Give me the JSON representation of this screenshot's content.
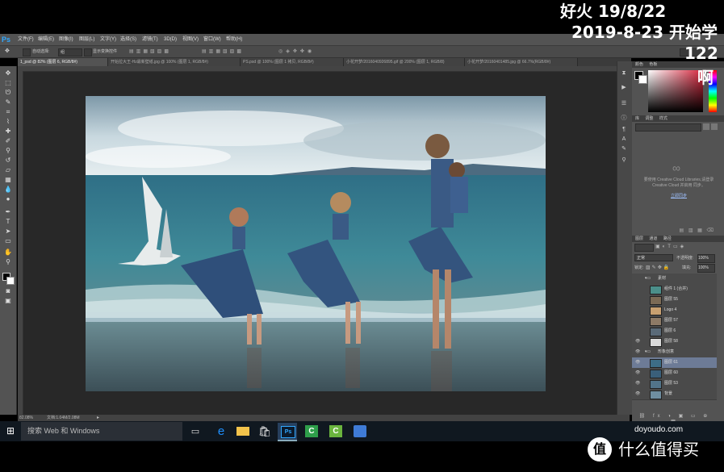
{
  "overlay": {
    "line1": "好火        19/8/22",
    "line2": "2019-8-23  开始学",
    "line3": "122",
    "line4": "啊"
  },
  "app": {
    "logo": "Ps",
    "menu": [
      "文件(F)",
      "编辑(E)",
      "图像(I)",
      "图层(L)",
      "文字(Y)",
      "选择(S)",
      "滤镜(T)",
      "3D(D)",
      "视图(V)",
      "窗口(W)",
      "帮助(H)"
    ]
  },
  "options_bar": {
    "auto_select_label": "自动选择:",
    "auto_select_value": "组",
    "show_transform_label": "显示变换控件"
  },
  "tabs": [
    "1_psd @ 82% (图层 6, RGB/8#)",
    "开始拉大王-Hz最新壁纸.jpg @ 100% (图层 1, RGB/8#)",
    "PS.psd @ 100% (图层 1 拷贝, RGB/8#)",
    "小花开梦/2016040926895.gif @ 200% (图层 1, RGB/8)",
    "小花开梦/20160401485.jpg @ 66.7%(RGB/8#)"
  ],
  "status": {
    "zoom": "82.08%",
    "doc": "文档:1.04M/2.08M"
  },
  "color_panel": {
    "tabs": [
      "颜色",
      "色板"
    ],
    "accent": "#d7263d"
  },
  "lib_panel": {
    "tabs": [
      "库",
      "调整",
      "样式"
    ],
    "message": "要使用 Creative Cloud Libraries,请登录 Creative Cloud 并启用 同步。",
    "link": "立即同步"
  },
  "layers_panel": {
    "tabs": [
      "图层",
      "通道",
      "路径"
    ],
    "blend_mode": "正常",
    "opacity_label": "不透明度:",
    "opacity": "100%",
    "fill_label": "填充:",
    "fill": "100%",
    "lock_label": "锁定:",
    "groups": [
      {
        "name": "素材",
        "layers": [
          "组件 1 (合并)",
          "图层 55",
          "Logo 4",
          "图层 57",
          "图层 6",
          "图层 58"
        ]
      },
      {
        "name": "形象创意",
        "layers": [
          "图层 61",
          "图层 60",
          "图层 53",
          "背景"
        ]
      }
    ]
  },
  "taskbar": {
    "search_placeholder": "搜索 Web 和 Windows"
  },
  "watermark": {
    "site": "doyoudo.com",
    "brand": "什么值得买",
    "logo": "值"
  }
}
